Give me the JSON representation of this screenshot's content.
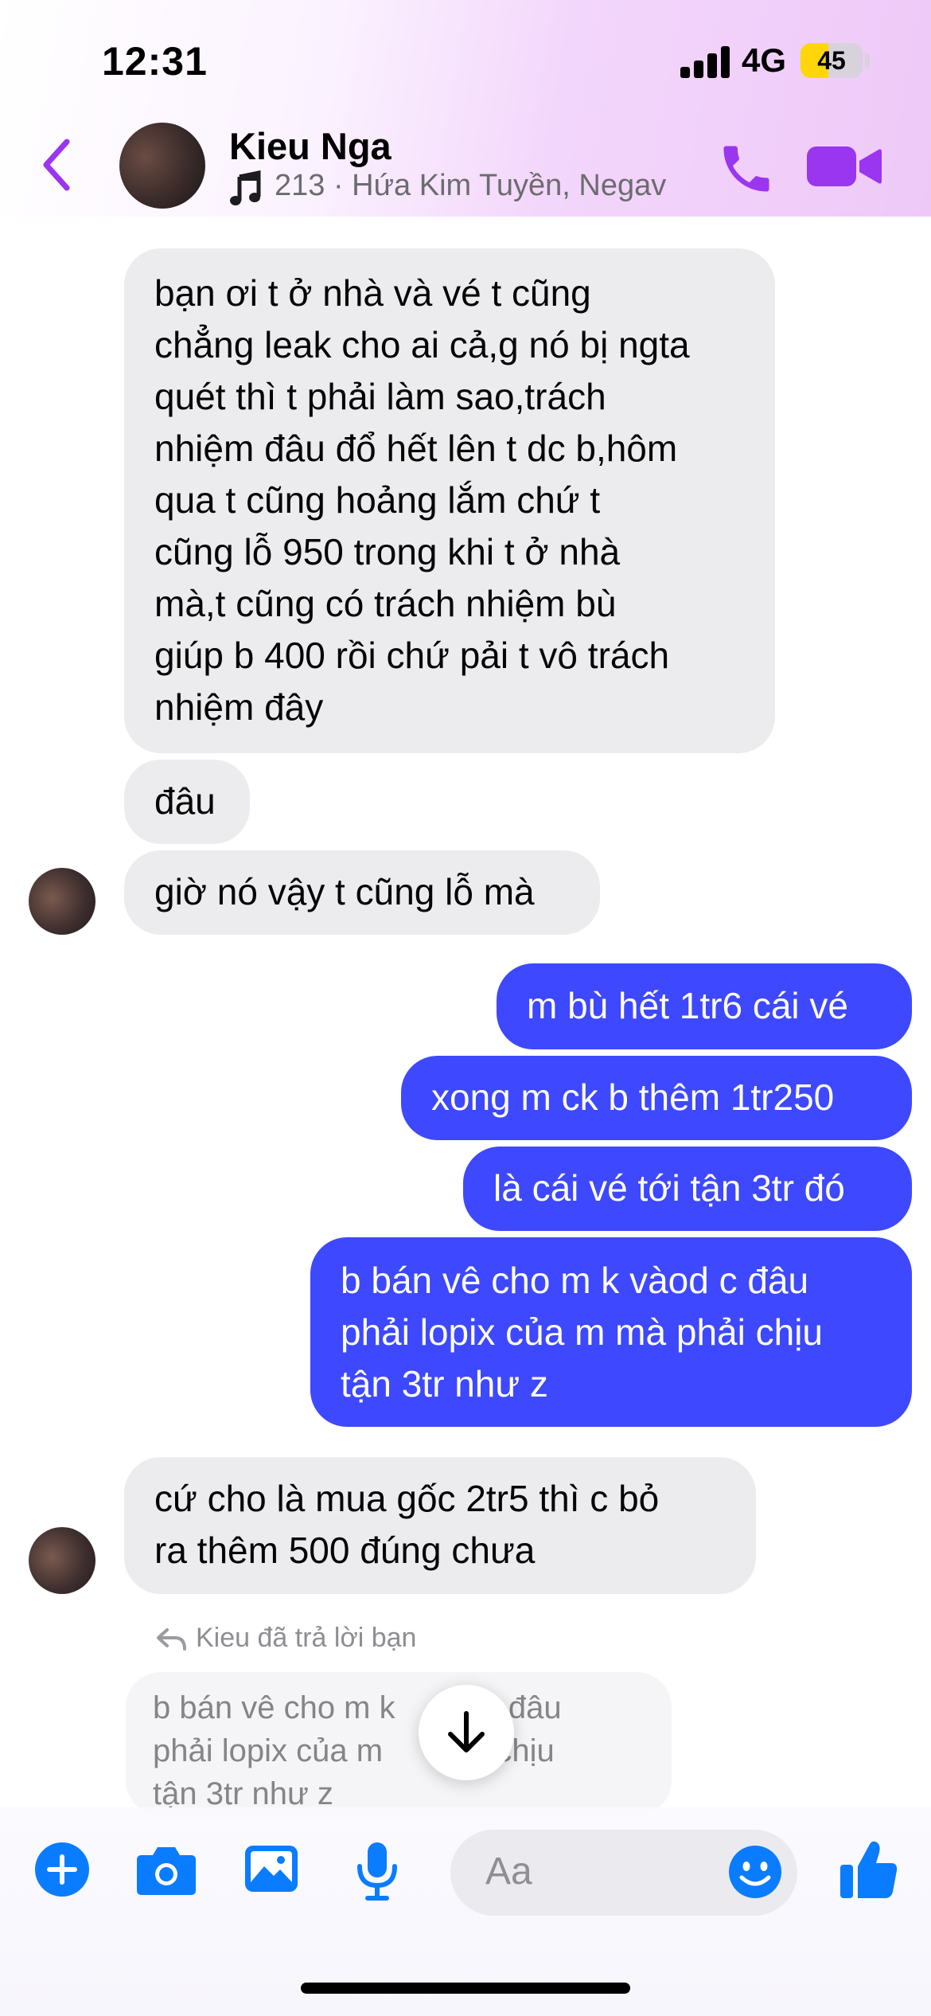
{
  "status_bar": {
    "time": "12:31",
    "network": "4G",
    "battery": "45",
    "battery_level": 0.45
  },
  "header": {
    "contact_name": "Kieu Nga",
    "now_playing": "213 · Hứa Kim Tuyền, Negav",
    "back_icon": "chevron-left-icon",
    "call_icon": "phone-icon",
    "video_icon": "video-camera-icon",
    "accent_color": "#9a35f0"
  },
  "messages": [
    {
      "direction": "incoming",
      "lines": [
        "bạn ơi t ở nhà và vé t cũng",
        "chẳng leak cho ai cả,g nó bị ngta",
        "quét thì t phải làm sao,trách",
        "nhiệm đâu đổ hết lên t dc b,hôm",
        "qua t cũng hoảng lắm chứ t",
        "cũng lỗ 950 trong khi t ở nhà",
        "mà,t cũng có trách nhiệm bù",
        "giúp b 400 rồi chứ pải t vô trách",
        "nhiệm đây"
      ]
    },
    {
      "direction": "incoming",
      "lines": [
        "đâu"
      ]
    },
    {
      "direction": "incoming",
      "lines": [
        "giờ nó vậy t cũng lỗ mà"
      ]
    },
    {
      "direction": "outgoing",
      "lines": [
        "m bù hết 1tr6 cái vé"
      ]
    },
    {
      "direction": "outgoing",
      "lines": [
        "xong m ck b thêm 1tr250"
      ]
    },
    {
      "direction": "outgoing",
      "lines": [
        "là cái vé tới tận 3tr đó"
      ]
    },
    {
      "direction": "outgoing",
      "lines": [
        "b bán vê cho m k vàod c đâu",
        "phải lopix của m mà phải chịu",
        "tận 3tr như z"
      ]
    },
    {
      "direction": "incoming",
      "lines": [
        "cứ cho là mua gốc 2tr5 thì c bỏ",
        "ra thêm 500 đúng chưa"
      ]
    }
  ],
  "reply": {
    "label": "Kieu đã trả lời bạn",
    "quoted_lines": [
      "b bán vê cho m k       d c đâu",
      "phải lopix của m       hải chịu",
      "tận 3tr như z"
    ]
  },
  "composer": {
    "placeholder": "Aa",
    "icons": [
      "plus-icon",
      "camera-icon",
      "image-icon",
      "microphone-icon",
      "emoji-icon",
      "thumbs-up-icon"
    ],
    "accent_color": "#0a7cff"
  },
  "colors": {
    "incoming_bubble": "#ececef",
    "outgoing_bubble": "#3d48ff"
  }
}
